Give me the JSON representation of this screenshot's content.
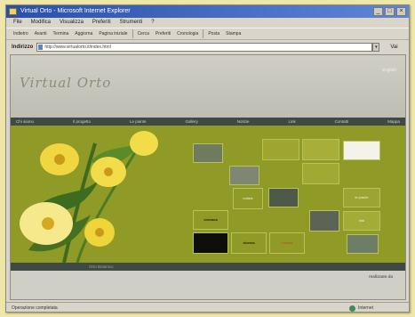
{
  "window": {
    "title": "Virtual Orto - Microsoft Internet Explorer",
    "controls": [
      "_",
      "□",
      "×"
    ]
  },
  "menubar": [
    "File",
    "Modifica",
    "Visualizza",
    "Preferiti",
    "Strumenti",
    "?"
  ],
  "toolbar": {
    "buttons": [
      "Indietro",
      "Avanti",
      "Termina",
      "Aggiorna",
      "Pagina iniziale",
      "Cerca",
      "Preferiti",
      "Cronologia",
      "Posta",
      "Stampa"
    ]
  },
  "address": {
    "label": "Indirizzo",
    "url": "http://www.virtualorto.it/index.html",
    "go_label": "Vai"
  },
  "site": {
    "logo": "Virtual Orto",
    "header_link": "english",
    "nav": [
      "Chi siamo",
      "Il progetto",
      "Le piante",
      "Gallery",
      "Notizie",
      "Link",
      "Contatti",
      "Mappa"
    ],
    "tiles": {
      "dark_1": "cronaca",
      "dark_2": "ricerca",
      "red": "contatti",
      "olive": "notizie",
      "green_1": "le piante",
      "green_2": "il giardino",
      "green_3": "didattica",
      "green_4": "link"
    },
    "footer_text": "Orto Botanico",
    "bottom_note": "realizzato da"
  },
  "status": {
    "text": "Operazione completata",
    "zone": "Internet"
  },
  "colors": {
    "stage": "#8f9a27",
    "nav_bar": "#3f4a45",
    "title_bar": "#2a4fa8"
  }
}
